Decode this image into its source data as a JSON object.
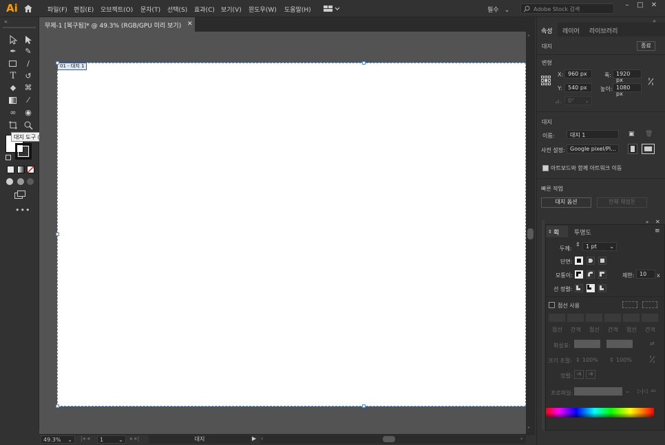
{
  "app": {
    "logo": "Ai"
  },
  "menu": [
    "파일(F)",
    "편집(E)",
    "오브젝트(O)",
    "문자(T)",
    "선택(S)",
    "효과(C)",
    "보기(V)",
    "윈도우(W)",
    "도움말(H)"
  ],
  "workspace": {
    "label": "필수"
  },
  "search": {
    "placeholder": "Adobe Stock 검색"
  },
  "document_tab": {
    "title": "무제-1 [복구됨]* @ 49.3% (RGB/GPU 미리 보기)"
  },
  "artboard": {
    "label": "01 - 대지 1"
  },
  "tooltip": {
    "text": "대지 도구 (Shift+O)"
  },
  "status": {
    "zoom": "49.3%",
    "page": "1",
    "tool_name": "대지"
  },
  "panel": {
    "tabs": [
      "속성",
      "레이어",
      "라이브러리"
    ],
    "section_artboard": "대지",
    "finish_button": "종료",
    "transform_title": "변형",
    "x_label": "X:",
    "x_value": "960 px",
    "y_label": "Y:",
    "y_value": "540 px",
    "w_label": "폭:",
    "w_value": "1920 px",
    "h_label": "높이:",
    "h_value": "1080 px",
    "angle_value": "0°",
    "artboard_title": "대지",
    "name_label": "이름:",
    "name_value": "대지 1",
    "preset_label": "사전 설정:",
    "preset_value": "Google pixel/Pi...",
    "move_artwork_label": "아트보드와 함께 아트워크 이동",
    "quick_actions_title": "빠른 작업",
    "artboard_options_button": "대지 옵션",
    "rearrange_button": "전체 재정돈"
  },
  "stroke_panel": {
    "tabs": [
      "획",
      "투명도"
    ],
    "weight_label": "두께:",
    "weight_value": "1 pt",
    "cap_label": "단면:",
    "corner_label": "모퉁이:",
    "limit_label": "제한:",
    "limit_value": "10",
    "limit_unit": "x",
    "align_label": "선 정렬:",
    "dashed_label": "점선 사용",
    "dash_headers": [
      "점선",
      "간격",
      "점선",
      "간격",
      "점선",
      "간격"
    ],
    "arrow_label": "화살표:",
    "scale_label": "크기 조절:",
    "scale_value1": "100%",
    "scale_value2": "100%",
    "align_label2": "정렬:",
    "profile_label": "프로파일:"
  }
}
